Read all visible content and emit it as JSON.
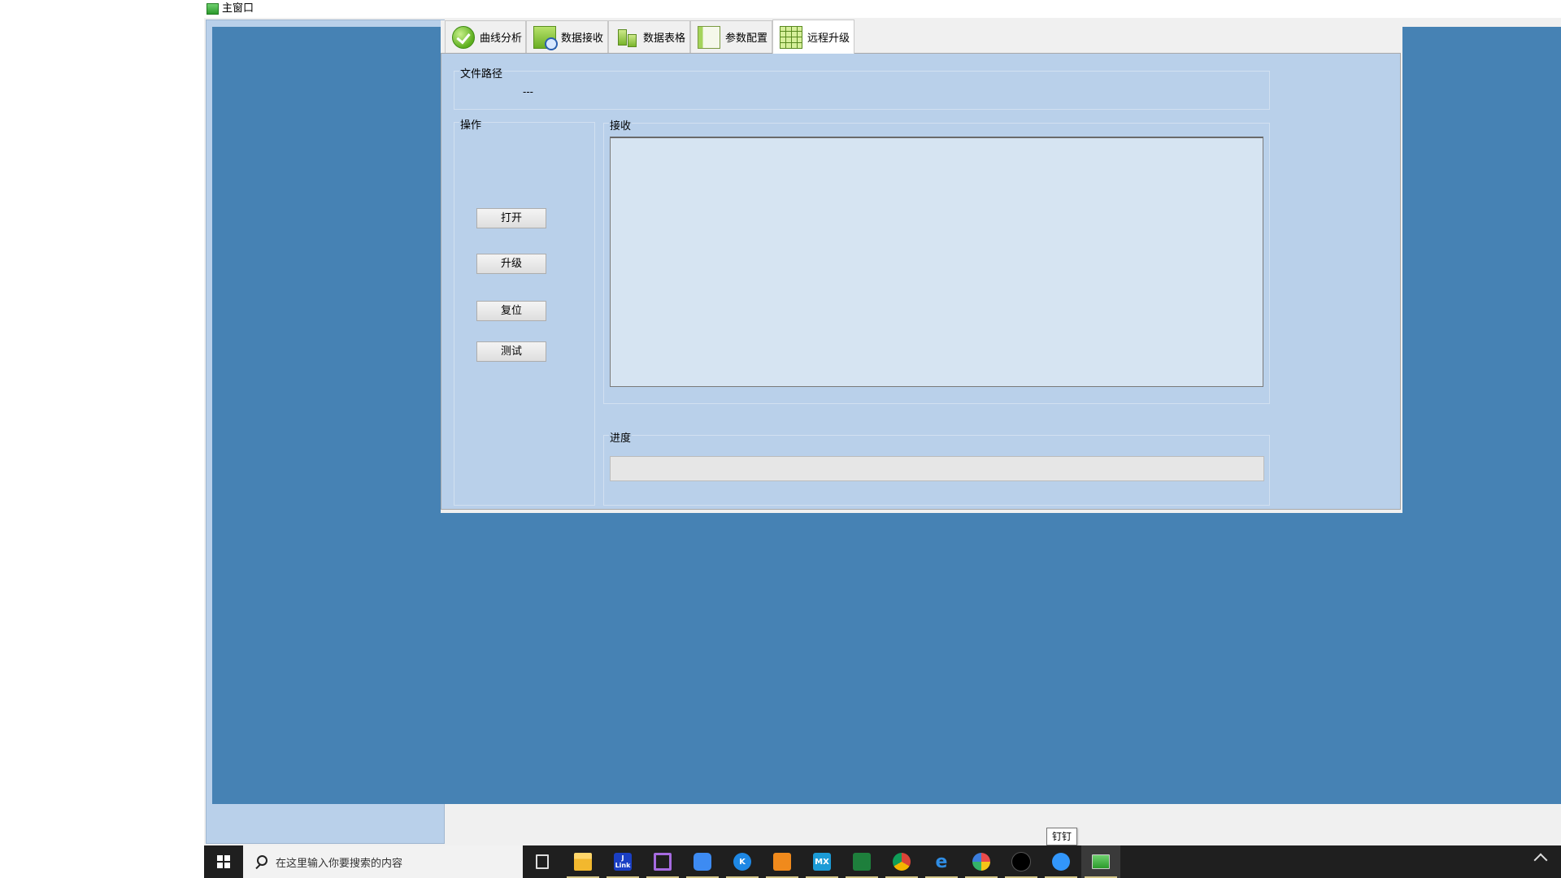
{
  "window": {
    "title": "主窗口"
  },
  "tabs": [
    {
      "label": "曲线分析",
      "active": false
    },
    {
      "label": "数据接收",
      "active": false
    },
    {
      "label": "数据表格",
      "active": false
    },
    {
      "label": "参数配置",
      "active": false
    },
    {
      "label": "远程升级",
      "active": true
    }
  ],
  "file_path": {
    "label": "文件路径",
    "value": "---"
  },
  "operations": {
    "label": "操作",
    "buttons": {
      "open": "打开",
      "upgrade": "升级",
      "reset": "复位",
      "test": "测试"
    }
  },
  "receive": {
    "label": "接收",
    "content": ""
  },
  "progress": {
    "label": "进度",
    "value_percent": 0
  },
  "taskbar": {
    "search_placeholder": "在这里输入你要搜索的内容",
    "tooltip": "钉钉",
    "apps": [
      {
        "name": "task-view",
        "label": ""
      },
      {
        "name": "file-explorer",
        "label": ""
      },
      {
        "name": "jlink",
        "label": "J\nLink"
      },
      {
        "name": "visual-studio",
        "label": ""
      },
      {
        "name": "feishu",
        "label": ""
      },
      {
        "name": "kugou",
        "label": "K"
      },
      {
        "name": "stm32cubemx-orange",
        "label": ""
      },
      {
        "name": "stm32cubemx",
        "label": "MX"
      },
      {
        "name": "green-app",
        "label": ""
      },
      {
        "name": "chrome",
        "label": ""
      },
      {
        "name": "edge",
        "label": "e"
      },
      {
        "name": "colorful-app",
        "label": ""
      },
      {
        "name": "dark-app",
        "label": ""
      },
      {
        "name": "dingtalk",
        "label": ""
      },
      {
        "name": "main-app",
        "label": ""
      }
    ]
  },
  "colors": {
    "mdi_background": "#4682b4",
    "panel_background": "#b9d0ea",
    "taskbar": "#1f1f1f"
  }
}
